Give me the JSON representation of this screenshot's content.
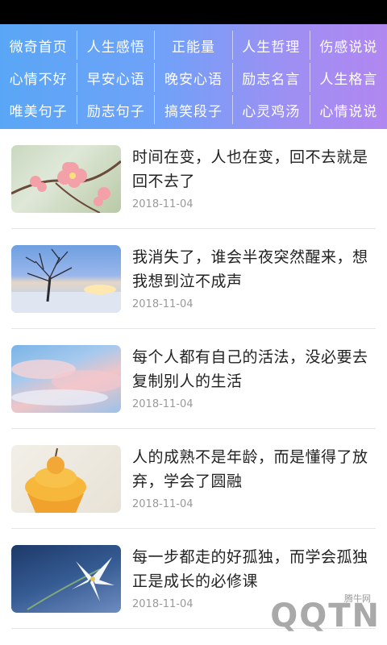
{
  "nav": {
    "rows": [
      [
        "微奇首页",
        "人生感悟",
        "正能量",
        "人生哲理",
        "伤感说说"
      ],
      [
        "心情不好",
        "早安心语",
        "晚安心语",
        "励志名言",
        "人生格言"
      ],
      [
        "唯美句子",
        "励志句子",
        "搞笑段子",
        "心灵鸡汤",
        "心情说说"
      ]
    ]
  },
  "articles": [
    {
      "title": "时间在变，人也在变，回不去就是回不去了",
      "date": "2018-11-04",
      "thumb": "plum-blossom"
    },
    {
      "title": "我消失了，谁会半夜突然醒来，想我想到泣不成声",
      "date": "2018-11-04",
      "thumb": "winter-tree-sunset"
    },
    {
      "title": "每个人都有自己的活法，没必要去复制别人的生活",
      "date": "2018-11-04",
      "thumb": "pink-clouds-sky"
    },
    {
      "title": "人的成熟不是年龄，而是懂得了放弃，学会了圆融",
      "date": "2018-11-04",
      "thumb": "orange-cupcake"
    },
    {
      "title": "每一步都走的好孤独，而学会孤独正是成长的必修课",
      "date": "2018-11-04",
      "thumb": "white-lily"
    }
  ],
  "watermark": {
    "text": "QQTN",
    "sub": "腾牛网"
  },
  "colors": {
    "nav_start": "#5aa6f6",
    "nav_end": "#b187f0",
    "title": "#222222",
    "date": "#9a9a9a"
  }
}
